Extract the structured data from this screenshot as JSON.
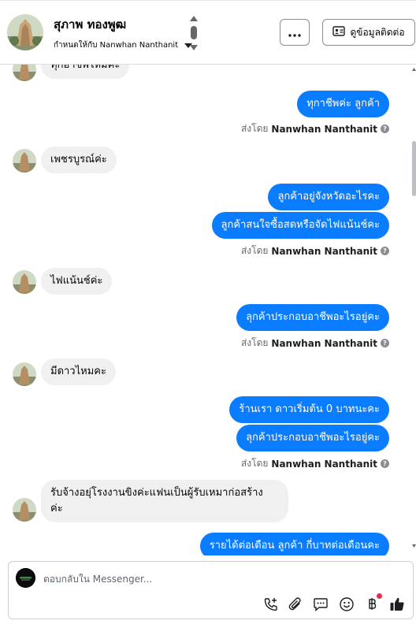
{
  "header": {
    "contact_name": "สุภาพ ทองพูฒ",
    "assigned_label": "กำหนดให้กับ Nanwhan Nanthanit",
    "more_label": "···",
    "contact_info_label": "ดูข้อมูลติดต่อ"
  },
  "thread": {
    "sent_by_prefix": "ส่งโดย",
    "agent_name": "Nanwhan Nanthanit",
    "messages": [
      {
        "dir": "in",
        "text": "ทุกอาชีพไหมคะ"
      },
      {
        "dir": "out",
        "text": "ทุกาชีพค่ะ ลูกค้า"
      },
      {
        "dir": "in",
        "text": "เพชรบูรณ์ค่ะ"
      },
      {
        "dir": "out",
        "text": "ลูกค้าอยู่จังหวัดอะไรคะ"
      },
      {
        "dir": "out",
        "text": "ลูกค้าสนใจซื้อสดหรือจัดไฟแน้นช์คะ"
      },
      {
        "dir": "in",
        "text": "ไฟแน้นช์ค่ะ"
      },
      {
        "dir": "out",
        "text": "ลุกค้าประกอบอาชีพอะไรอยู่คะ"
      },
      {
        "dir": "in",
        "text": "มีดาวไหมคะ"
      },
      {
        "dir": "out",
        "text": "ร้านเรา ดาวเริ่มต้น 0 บาทนะคะ"
      },
      {
        "dir": "out",
        "text": "ลุกค้าประกอบอาชีพอะไรอยู่คะ"
      },
      {
        "dir": "in",
        "text": "รับจ้างอยุ่โรงงานขิงค่ะแฟนเป็นผู้รับเหมาก่อสร้าง"
      },
      {
        "dir": "in",
        "text": "ค่ะ"
      },
      {
        "dir": "out",
        "text": "รายได้ต่อเดือน ลูกค้า กี่บาทต่อเดือนคะ"
      }
    ]
  },
  "composer": {
    "placeholder": "ตอบกลับใน Messenger...",
    "value": ""
  },
  "icons": [
    "scroll-stepper-icon",
    "more-icon",
    "contact-card-icon",
    "call-add-icon",
    "attachment-icon",
    "saved-replies-icon",
    "emoji-icon",
    "payment-icon",
    "like-icon"
  ],
  "colors": {
    "outgoing_bubble": "#0a7cff",
    "incoming_bubble": "#f0f0f0",
    "notification_dot": "#f02849",
    "like_icon": "#1c1e21"
  }
}
